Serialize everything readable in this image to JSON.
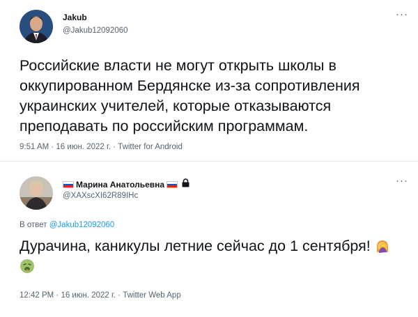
{
  "tweet": {
    "author_name": "Jakub",
    "author_handle": "@Jakub12092060",
    "text": "Российские власти не могут открыть школы в оккупированном Бердянске из-за сопротивления украинских учителей, которые отказываются преподавать по российским программам.",
    "time": "9:51 AM · 16 июн. 2022 г. · Twitter for Android",
    "more_label": "···"
  },
  "reply": {
    "author_name": "Марина Анатольевна",
    "author_handle": "@XAXscXI62R89IHc",
    "reply_prefix": "В ответ",
    "reply_to_handle": "@Jakub12092060",
    "text": "Дурачина, каникулы летние сейчас до 1 сентября!",
    "time": "12:42 PM · 16 июн. 2022 г. · Twitter Web App",
    "more_label": "···",
    "flag_icon": "russian-flag",
    "lock_icon": "lock-icon",
    "emojis": [
      "facepalm",
      "nauseated-face"
    ]
  },
  "colors": {
    "text": "#0f1419",
    "secondary": "#536471",
    "link": "#1d9bf0",
    "divider": "#e6e9ec"
  }
}
